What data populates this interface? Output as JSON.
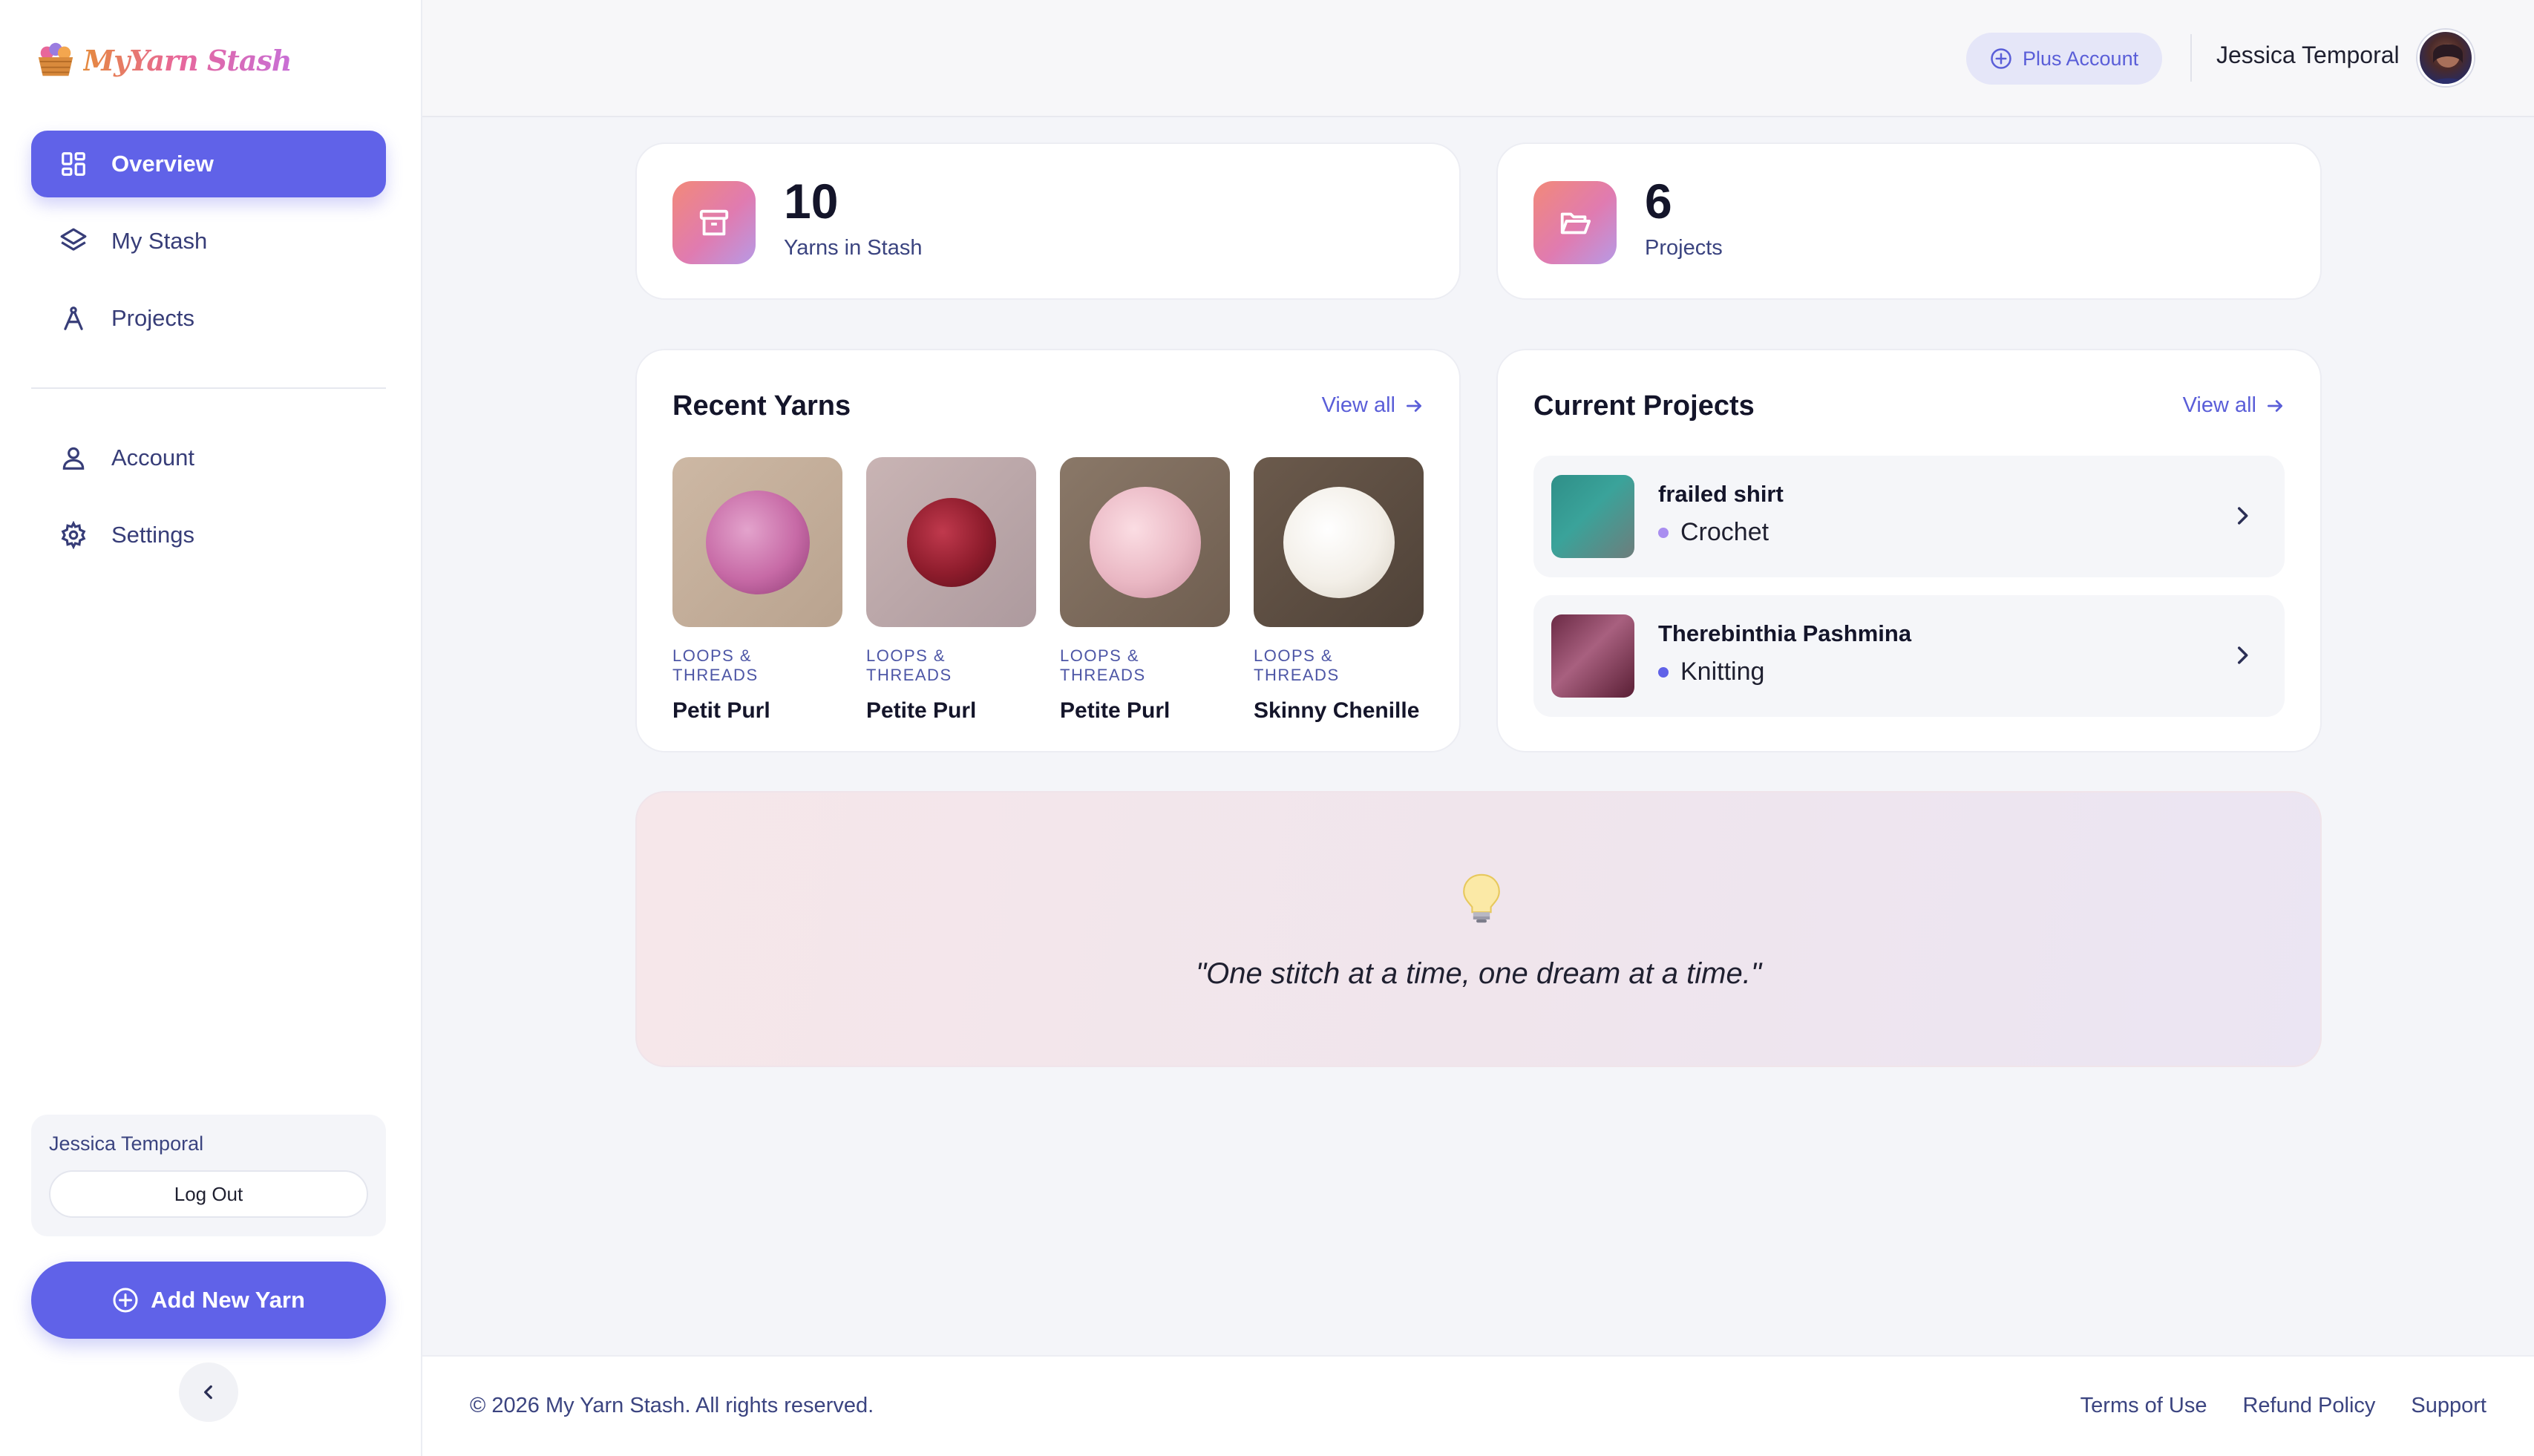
{
  "app": {
    "logo_text": "MyYarn Stash"
  },
  "sidebar": {
    "nav": [
      {
        "label": "Overview",
        "icon": "grid-icon",
        "active": true
      },
      {
        "label": "My Stash",
        "icon": "layers-icon",
        "active": false
      },
      {
        "label": "Projects",
        "icon": "compass-icon",
        "active": false
      }
    ],
    "nav_secondary": [
      {
        "label": "Account",
        "icon": "user-icon"
      },
      {
        "label": "Settings",
        "icon": "gear-icon"
      }
    ],
    "user_name": "Jessica Temporal",
    "logout_label": "Log Out",
    "add_yarn_label": "Add New Yarn"
  },
  "header": {
    "plan_badge": "Plus Account",
    "user_name": "Jessica Temporal"
  },
  "stats": [
    {
      "value": "10",
      "label": "Yarns in Stash",
      "icon": "archive-icon"
    },
    {
      "value": "6",
      "label": "Projects",
      "icon": "folder-open-icon"
    }
  ],
  "recent_yarns": {
    "title": "Recent Yarns",
    "view_all": "View all",
    "items": [
      {
        "brand": "Loops & Threads",
        "name": "Petit Purl",
        "color": "#c76aa6"
      },
      {
        "brand": "Loops & Threads",
        "name": "Petite Purl",
        "color": "#8e1c2c"
      },
      {
        "brand": "Loops & Threads",
        "name": "Petite Purl",
        "color": "#eab8c4"
      },
      {
        "brand": "Loops & Threads",
        "name": "Skinny Chenille",
        "color": "#f3efe8"
      }
    ]
  },
  "current_projects": {
    "title": "Current Projects",
    "view_all": "View all",
    "items": [
      {
        "name": "frailed shirt",
        "type": "Crochet",
        "dot_color": "#a98ef0"
      },
      {
        "name": "Therebinthia Pashmina",
        "type": "Knitting",
        "dot_color": "#6062e8"
      }
    ]
  },
  "quote": {
    "text": "\"One stitch at a time, one dream at a time.\"",
    "icon": "lightbulb-icon"
  },
  "footer": {
    "copyright": "© 2026 My Yarn Stash. All rights reserved.",
    "links": [
      "Terms of Use",
      "Refund Policy",
      "Support"
    ]
  },
  "colors": {
    "accent": "#6062e8",
    "text_muted": "#3b4480"
  }
}
